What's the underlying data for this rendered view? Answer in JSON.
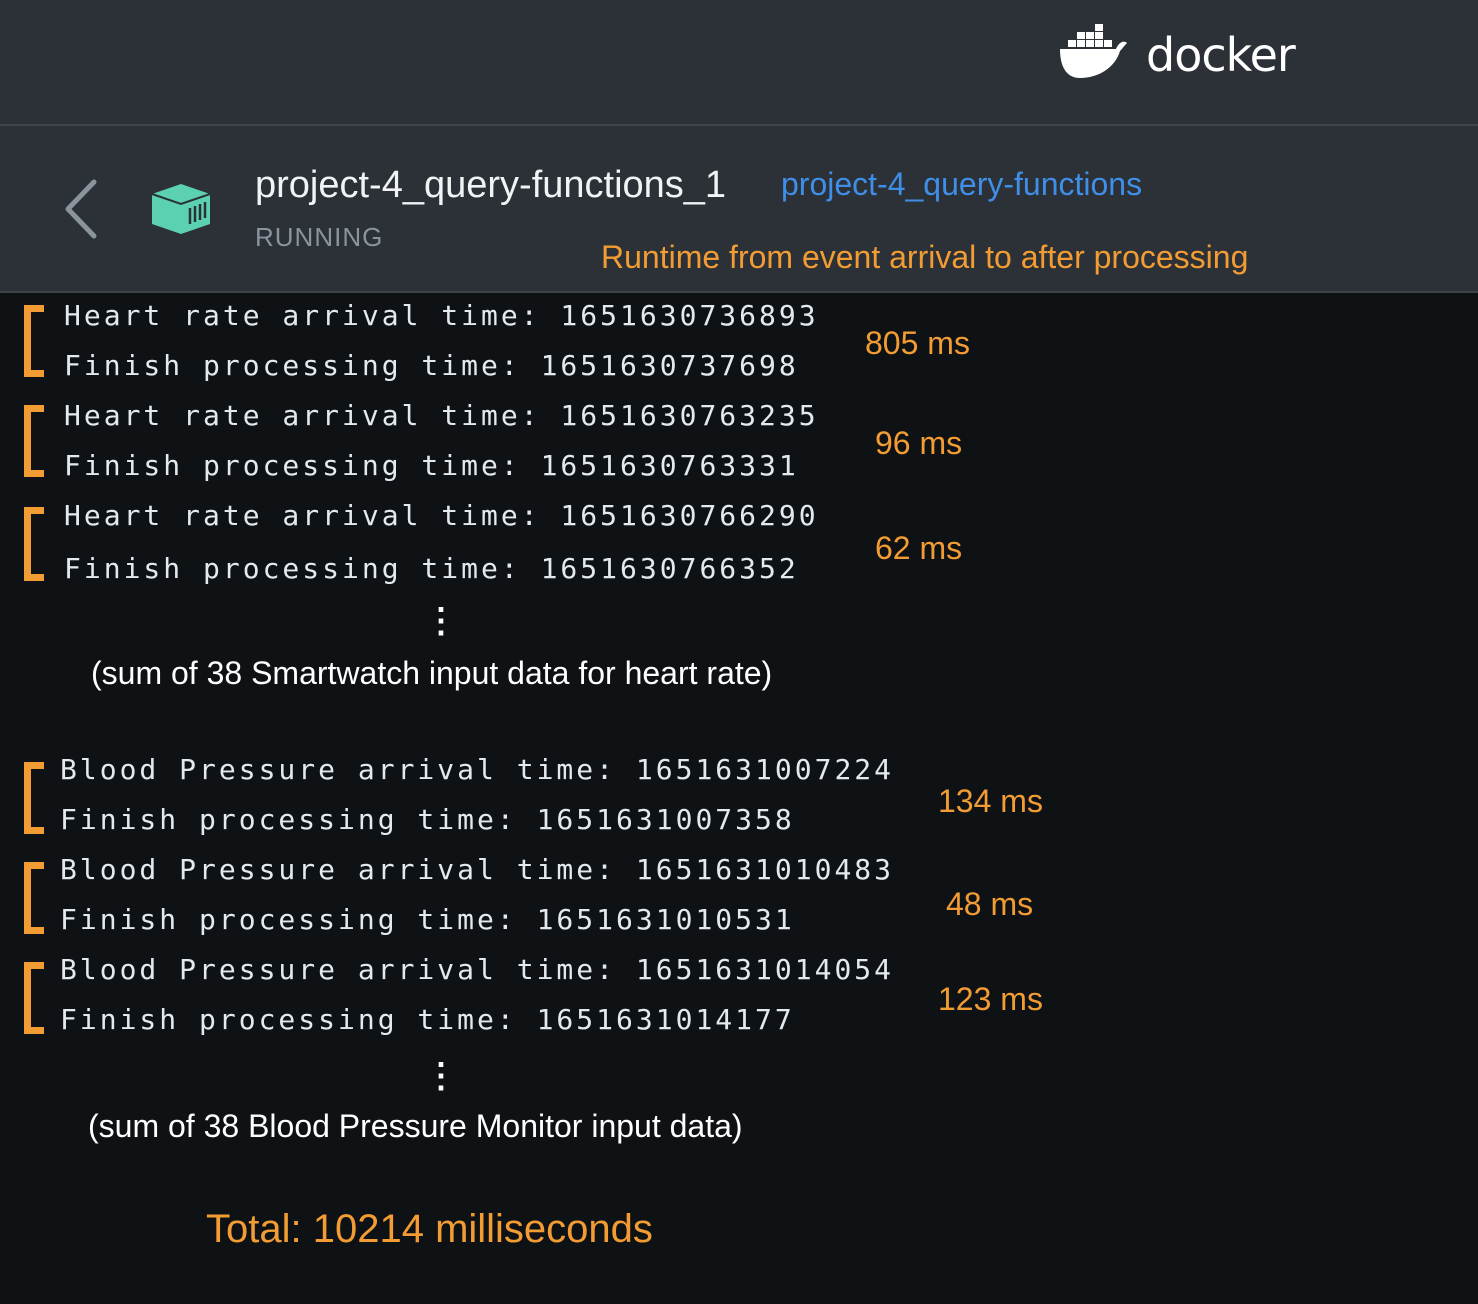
{
  "brand": {
    "wordmark": "docker",
    "logo_icon": "docker-whale-icon"
  },
  "container": {
    "name": "project-4_query-functions_1",
    "image_link": "project-4_query-functions",
    "status": "RUNNING",
    "icon": "container-icon"
  },
  "runtime_note": "Runtime from event arrival to after processing",
  "heart_rate": {
    "entries": [
      {
        "arrival": "Heart rate arrival time: 1651630736893",
        "finish": "Finish processing time: 1651630737698",
        "runtime": "805 ms"
      },
      {
        "arrival": "Heart rate arrival time: 1651630763235",
        "finish": "Finish processing time: 1651630763331",
        "runtime": "96 ms"
      },
      {
        "arrival": "Heart rate arrival time: 1651630766290",
        "finish": "Finish processing time: 1651630766352",
        "runtime": "62 ms"
      }
    ],
    "ellipsis": "⋮",
    "summary": "(sum of 38 Smartwatch input data for heart rate)"
  },
  "blood_pressure": {
    "entries": [
      {
        "arrival": "Blood Pressure arrival time: 1651631007224",
        "finish": "Finish processing time: 1651631007358",
        "runtime": "134 ms"
      },
      {
        "arrival": "Blood Pressure arrival time: 1651631010483",
        "finish": "Finish processing time: 1651631010531",
        "runtime": "48 ms"
      },
      {
        "arrival": "Blood Pressure arrival time: 1651631014054",
        "finish": "Finish processing time: 1651631014177",
        "runtime": "123 ms"
      }
    ],
    "ellipsis": "⋮",
    "summary": "(sum of 38 Blood Pressure Monitor input data)"
  },
  "total": "Total: 10214 milliseconds",
  "colors": {
    "accent": "#f39c33",
    "link": "#3f8ee8",
    "background": "#0f1215",
    "header": "#2b3136"
  }
}
